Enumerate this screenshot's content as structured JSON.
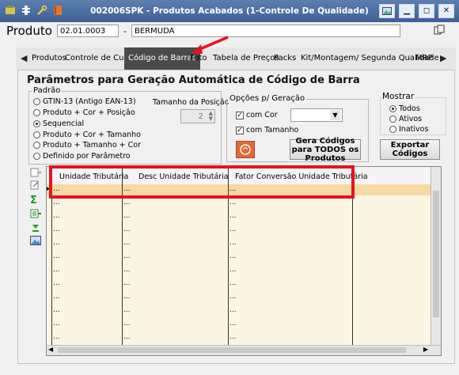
{
  "titlebar": {
    "title": "002006SPK - Produtos Acabados (1-Controle De Qualidade)"
  },
  "product": {
    "label": "Produto",
    "code": "02.01.0003",
    "separator": "-",
    "name": "BERMUDA"
  },
  "tabs": [
    "Produtos",
    "Controle de Custo",
    "Código de Barras",
    "Foto",
    "Tabela de Preços",
    "Packs",
    "Kit/Montagem/ Segunda Qualidade",
    "MRP"
  ],
  "active_tab": "Código de Barras",
  "section_title": "Parâmetros para Geração Automática de Código de Barra",
  "padrao": {
    "title": "Padrão",
    "options": [
      "GTIN-13 (Antigo EAN-13)",
      "Produto + Cor + Posição",
      "Sequencial",
      "Produto + Cor + Tamanho",
      "Produto + Tamanho + Cor",
      "Definido por Parâmetro"
    ],
    "selected": "Sequencial"
  },
  "tamanho": {
    "label": "Tamanho da Posição",
    "value": "2"
  },
  "opcoes": {
    "title": "Opções p/ Geração",
    "com_cor": "com Cor",
    "com_tamanho": "com Tamanho"
  },
  "gera_button": "Gera Códigos para TODOS os Produtos",
  "mostrar": {
    "title": "Mostrar",
    "options": [
      "Todos",
      "Ativos",
      "Inativos"
    ],
    "selected": "Todos"
  },
  "exportar_button": "Exportar Códigos",
  "grid": {
    "columns": [
      "Unidade Tributária",
      "Desc Unidade Tributária",
      "Fator Conversão Unidade Tributária"
    ],
    "row_marker": "...",
    "placeholder": "..."
  },
  "colors": {
    "titlebar": "#4a6ea3",
    "accent_selected_row": "#f7d9a5",
    "highlight": "#e4141e",
    "grid_bg": "#fdf5e3"
  }
}
